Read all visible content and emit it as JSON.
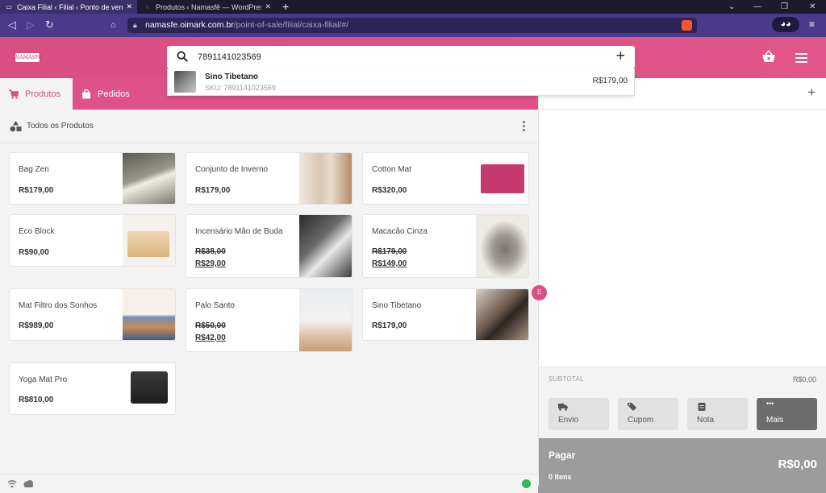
{
  "browser": {
    "tabs": [
      {
        "title": "Caixa Filial ‹ Filial ‹ Ponto de venda",
        "active": true
      },
      {
        "title": "Produtos ‹ Namasfê — WordPress",
        "active": false
      }
    ],
    "url_host": "namasfe.oimark.com.br",
    "url_path": "/point-of-sale/filial/caixa-filial/#/"
  },
  "header": {
    "logo_text": "NAMASFÊ",
    "search_value": "7891141023569"
  },
  "suggestion": {
    "name": "Sino Tibetano",
    "sku": "SKU: 7891141023569",
    "price": "R$179,00"
  },
  "tabs": {
    "products": "Produtos",
    "orders": "Pedidos"
  },
  "category": {
    "title": "Todos os Produtos"
  },
  "products": [
    {
      "name": "Bag Zen",
      "price": "R$179,00",
      "old_price": null
    },
    {
      "name": "Conjunto de Inverno",
      "price": "R$179,00",
      "old_price": null
    },
    {
      "name": "Cotton Mat",
      "price": "R$320,00",
      "old_price": null
    },
    {
      "name": "Eco Block",
      "price": "R$90,00",
      "old_price": null
    },
    {
      "name": "Incensário Mão de Buda",
      "price": "R$29,00",
      "old_price": "R$38,00"
    },
    {
      "name": "Macacão Cinza",
      "price": "R$149,00",
      "old_price": "R$179,00"
    },
    {
      "name": "Mat Filtro dos Sonhos",
      "price": "R$989,00",
      "old_price": null
    },
    {
      "name": "Palo Santo",
      "price": "R$42,00",
      "old_price": "R$50,00"
    },
    {
      "name": "Sino Tibetano",
      "price": "R$179,00",
      "old_price": null
    },
    {
      "name": "Yoga Mat Pro",
      "price": "R$810,00",
      "old_price": null
    }
  ],
  "cart": {
    "subtotal_label": "SUBTOTAL",
    "subtotal_value": "R$0,00",
    "actions": [
      "Envio",
      "Cupom",
      "Nota",
      "Mais"
    ],
    "pay_label": "Pagar",
    "pay_value": "R$0,00",
    "items_count": "0 Itens"
  },
  "colors": {
    "brand": "#d94f83",
    "online": "#2ebd4c"
  }
}
